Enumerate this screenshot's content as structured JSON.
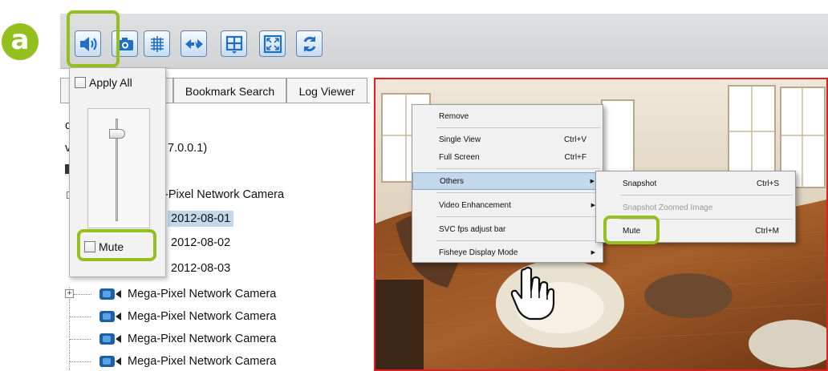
{
  "callout": {
    "letter": "a"
  },
  "toolbar": {
    "buttons": [
      {
        "icon": "speaker-icon",
        "name": "audio-button"
      },
      {
        "icon": "camera-icon",
        "name": "snapshot-button"
      },
      {
        "icon": "video-enhance-icon",
        "name": "enhance-button"
      },
      {
        "icon": "ptz-icon",
        "name": "ptz-button"
      },
      {
        "icon": "layout-grid-icon",
        "name": "layout-button"
      },
      {
        "icon": "fullscreen-icon",
        "name": "fullscreen-button"
      },
      {
        "icon": "refresh-icon",
        "name": "refresh-button"
      }
    ]
  },
  "tabs": {
    "bookmark": "Bookmark Search",
    "log": "Log Viewer"
  },
  "tree": {
    "items": [
      {
        "text": "c"
      },
      {
        "text": "v"
      },
      {
        "text": "7.0.0.1)"
      },
      {
        "text": "-Pixel Network Camera"
      },
      {
        "text": "2012-08-01"
      },
      {
        "text": "2012-08-02"
      },
      {
        "text": "2012-08-03"
      },
      {
        "text": "Mega-Pixel Network Camera"
      },
      {
        "text": "Mega-Pixel Network Camera"
      },
      {
        "text": "Mega-Pixel Network Camera"
      },
      {
        "text": "Mega-Pixel Network Camera"
      }
    ]
  },
  "audio_popup": {
    "apply_all": "Apply All",
    "mute": "Mute",
    "volume_level": 0.85
  },
  "context_menu": {
    "items": [
      "Remove",
      "Single View",
      "Full Screen",
      "Others",
      "Video Enhancement",
      "SVC fps adjust bar",
      "Fisheye Display Mode"
    ],
    "shortcuts": {
      "single_view": "Ctrl+V",
      "full_screen": "Ctrl+F"
    }
  },
  "submenu": {
    "items": [
      "Snapshot",
      "Snapshot Zoomed Image",
      "Mute"
    ],
    "shortcuts": {
      "snapshot": "Ctrl+S",
      "mute": "Ctrl+M"
    }
  },
  "colors": {
    "highlight": "#93c01f",
    "selected": "#c4d8ec",
    "video_border": "#e02020"
  }
}
